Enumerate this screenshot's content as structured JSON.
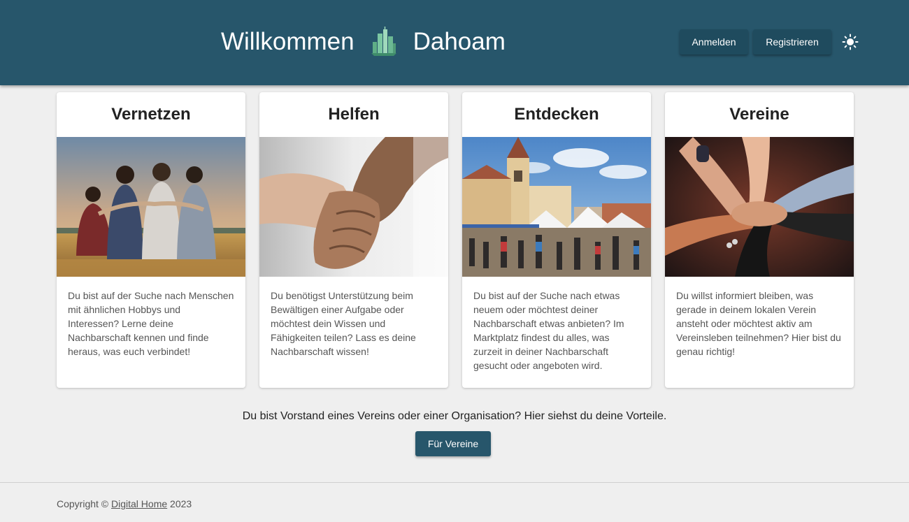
{
  "header": {
    "title_left": "Willkommen",
    "title_right": "Dahoam",
    "logo_icon": "city-skyline-logo",
    "login_label": "Anmelden",
    "register_label": "Registrieren",
    "theme_icon": "sun-icon",
    "background_color": "#27566b"
  },
  "cards": [
    {
      "title": "Vernetzen",
      "image": "friends-in-field-photo",
      "text": "Du bist auf der Suche nach Menschen mit ähnlichen Hobbys und Interessen? Lerne deine Nachbarschaft kennen und finde heraus, was euch verbindet!"
    },
    {
      "title": "Helfen",
      "image": "holding-hands-photo",
      "text": "Du benötigst Unterstützung beim Bewältigen einer Aufgabe oder möchtest dein Wissen und Fähigkeiten teilen? Lass es deine Nachbarschaft wissen!"
    },
    {
      "title": "Entdecken",
      "image": "town-market-photo",
      "text": "Du bist auf der Suche nach etwas neuem oder möchtest deiner Nachbarschaft etwas anbieten? Im Marktplatz findest du alles, was zurzeit in deiner Nachbarschaft gesucht oder angeboten wird."
    },
    {
      "title": "Vereine",
      "image": "stacked-hands-photo",
      "text": "Du willst informiert bleiben, was gerade in deinem lokalen Verein ansteht oder möchtest aktiv am Vereinsleben teilnehmen? Hier bist du genau richtig!"
    }
  ],
  "organization": {
    "text": "Du bist Vorstand eines Vereins oder einer Organisation? Hier siehst du deine Vorteile.",
    "button_label": "Für Vereine"
  },
  "footer": {
    "copyright_prefix": "Copyright © ",
    "link_text": "Digital Home",
    "year": " 2023"
  }
}
